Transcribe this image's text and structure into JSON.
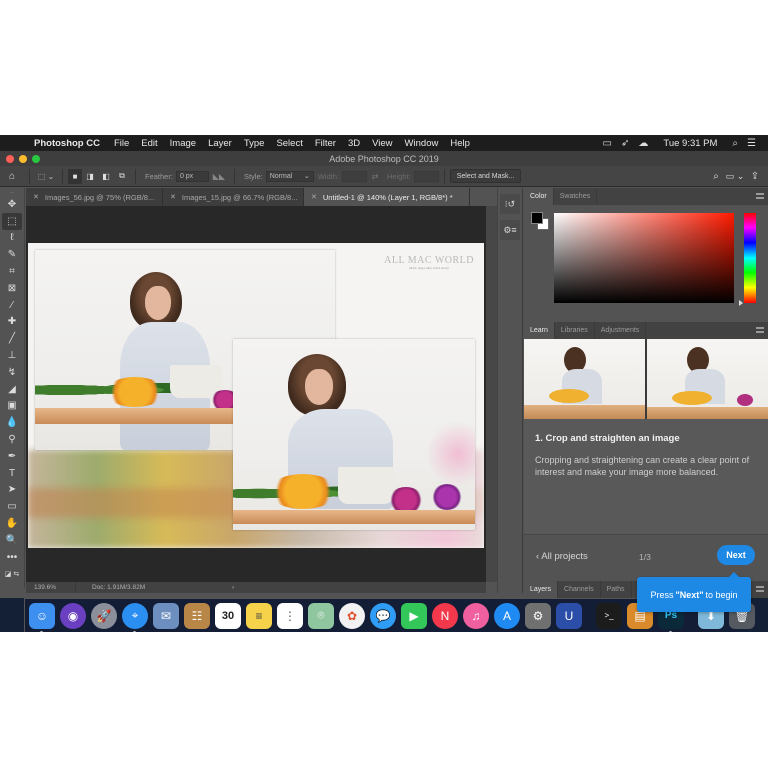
{
  "menubar": {
    "apple_icon": "apple-logo-icon",
    "app_name": "Photoshop CC",
    "items": [
      "File",
      "Edit",
      "Image",
      "Layer",
      "Type",
      "Select",
      "Filter",
      "3D",
      "View",
      "Window",
      "Help"
    ],
    "status_icons": [
      "airplay-display-icon",
      "cursor-pen-icon",
      "creative-cloud-icon"
    ],
    "clock": "Tue 9:31 PM",
    "search_icon": "spotlight-search-icon",
    "list_icon": "notification-center-icon"
  },
  "window": {
    "title": "Adobe Photoshop CC 2019",
    "traffic_colors": [
      "#fe5f57",
      "#febc2e",
      "#28c840"
    ]
  },
  "options_bar": {
    "feather_label": "Feather:",
    "feather_value": "0 px",
    "style_label": "Style:",
    "style_value": "Normal",
    "width_label": "Width:",
    "height_label": "Height:",
    "select_mask_label": "Select and Mask..."
  },
  "tools": [
    {
      "name": "move-tool",
      "glyph": "✥"
    },
    {
      "name": "rectangular-marquee-tool",
      "glyph": "⬚",
      "active": true
    },
    {
      "name": "lasso-tool",
      "glyph": "ℓ"
    },
    {
      "name": "quick-selection-tool",
      "glyph": "✎"
    },
    {
      "name": "crop-tool",
      "glyph": "⌗"
    },
    {
      "name": "frame-tool",
      "glyph": "⊠"
    },
    {
      "name": "eyedropper-tool",
      "glyph": "⁄"
    },
    {
      "name": "spot-healing-brush-tool",
      "glyph": "✚"
    },
    {
      "name": "brush-tool",
      "glyph": "╱"
    },
    {
      "name": "clone-stamp-tool",
      "glyph": "⊥"
    },
    {
      "name": "history-brush-tool",
      "glyph": "↯"
    },
    {
      "name": "eraser-tool",
      "glyph": "◢"
    },
    {
      "name": "gradient-tool",
      "glyph": "▣"
    },
    {
      "name": "blur-tool",
      "glyph": "💧"
    },
    {
      "name": "dodge-tool",
      "glyph": "⚲"
    },
    {
      "name": "pen-tool",
      "glyph": "✒"
    },
    {
      "name": "type-tool",
      "glyph": "T"
    },
    {
      "name": "path-selection-tool",
      "glyph": "➤"
    },
    {
      "name": "rectangle-tool",
      "glyph": "▭"
    },
    {
      "name": "hand-tool",
      "glyph": "✋"
    },
    {
      "name": "zoom-tool",
      "glyph": "🔍"
    },
    {
      "name": "edit-toolbar",
      "glyph": "•••"
    }
  ],
  "tabs": [
    {
      "label": "Images_56.jpg @ 75% (RGB/8...",
      "active": false
    },
    {
      "label": "Images_15.jpg @ 66.7% (RGB/8...",
      "active": false
    },
    {
      "label": "Untitled-1 @ 140% (Layer 1, RGB/8*) *",
      "active": true
    }
  ],
  "canvas": {
    "watermark_main": "ALL MAC WORLD",
    "watermark_sub": "MAC Apps One Click Away"
  },
  "statusbar": {
    "zoom": "139.6%",
    "doc": "Doc: 1.91M/3.82M",
    "arrow": "›"
  },
  "color_panel": {
    "tabs": [
      "Color",
      "Swatches"
    ],
    "foreground": "#000000",
    "background": "#ffffff"
  },
  "learn_panel": {
    "tabs": [
      "Learn",
      "Libraries",
      "Adjustments"
    ],
    "step_title": "1.  Crop and straighten an image",
    "step_description": "Cropping and straightening can create a clear point of interest and make your image more balanced.",
    "all_projects": "‹  All projects",
    "page_indicator": "1/3",
    "next_label": "Next"
  },
  "layers_panel": {
    "tabs": [
      "Layers",
      "Channels",
      "Paths"
    ]
  },
  "tooltip": {
    "prefix": "Press",
    "emphasis": "\"Next\"",
    "suffix": "to begin"
  },
  "dock": [
    {
      "name": "finder",
      "glyph": "☺",
      "bg": "#3d8ff0",
      "running": true
    },
    {
      "name": "siri",
      "glyph": "◉",
      "bg": "#6a3fc0",
      "round": true
    },
    {
      "name": "launchpad",
      "glyph": "🚀",
      "bg": "#8a8f99",
      "round": true
    },
    {
      "name": "safari",
      "glyph": "⌖",
      "bg": "#2a8ff0",
      "round": true,
      "running": true
    },
    {
      "name": "mail-preview",
      "glyph": "✉",
      "bg": "#6d8fbf"
    },
    {
      "name": "contacts",
      "glyph": "☷",
      "bg": "#b88748"
    },
    {
      "name": "calendar",
      "glyph": "30",
      "bg": "#ffffff",
      "fg": "#222"
    },
    {
      "name": "notes",
      "glyph": "≡",
      "bg": "#f6d14a",
      "fg": "#444"
    },
    {
      "name": "reminders",
      "glyph": "⋮",
      "bg": "#ffffff",
      "fg": "#555"
    },
    {
      "name": "maps",
      "glyph": "⌾",
      "bg": "#8fc6a0"
    },
    {
      "name": "photos",
      "glyph": "✿",
      "bg": "#f2f2f2",
      "fg": "#e0502e",
      "round": true
    },
    {
      "name": "messages",
      "glyph": "💬",
      "bg": "#2f9df5",
      "round": true
    },
    {
      "name": "facetime",
      "glyph": "▶",
      "bg": "#33c759"
    },
    {
      "name": "news",
      "glyph": "N",
      "bg": "#f2384a",
      "round": true
    },
    {
      "name": "itunes",
      "glyph": "♫",
      "bg": "#f05fa0",
      "round": true
    },
    {
      "name": "app-store",
      "glyph": "A",
      "bg": "#1f8af2",
      "round": true
    },
    {
      "name": "system-preferences",
      "glyph": "⚙",
      "bg": "#707070"
    },
    {
      "name": "magnet",
      "glyph": "U",
      "bg": "#2b4ea8"
    },
    {
      "sep": true
    },
    {
      "name": "terminal",
      "glyph": ">_",
      "bg": "#1c1c1c"
    },
    {
      "name": "archive-utility",
      "glyph": "▤",
      "bg": "#d98a2a"
    },
    {
      "name": "photoshop",
      "glyph": "Ps",
      "bg": "#0a2a3a",
      "fg": "#31c5f0",
      "running": true
    },
    {
      "sep": true
    },
    {
      "name": "downloads-folder",
      "glyph": "⬇",
      "bg": "#7fb8d8"
    },
    {
      "name": "trash",
      "glyph": "🗑",
      "bg": "#555a60"
    }
  ]
}
